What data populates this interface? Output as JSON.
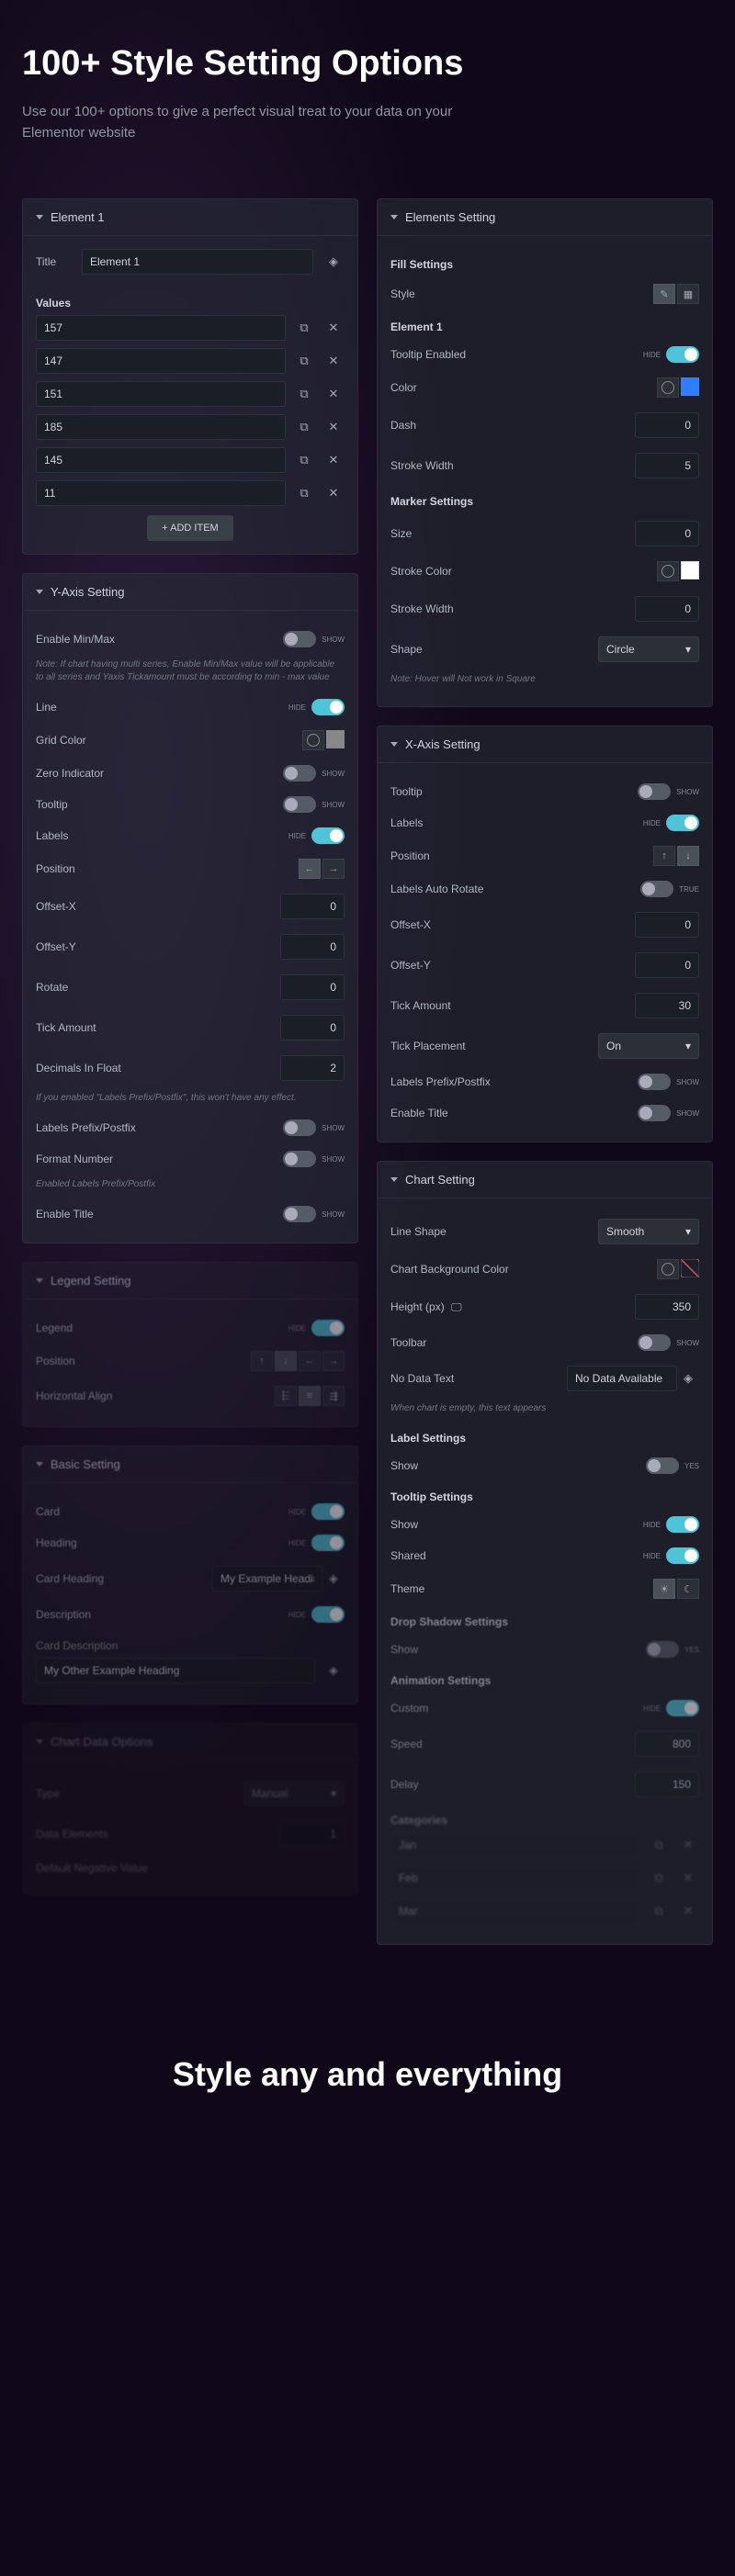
{
  "hero": {
    "title": "100+ Style Setting Options",
    "subtitle": "Use our 100+ options to give a perfect visual treat to your data on your Elementor website"
  },
  "element1": {
    "header": "Element 1",
    "titleLabel": "Title",
    "titleValue": "Element 1",
    "valuesLabel": "Values",
    "values": [
      "157",
      "147",
      "151",
      "185",
      "145",
      "11"
    ],
    "addItem": "+  ADD ITEM"
  },
  "yaxis": {
    "header": "Y-Axis Setting",
    "enableMinMax": "Enable Min/Max",
    "note1": "Note: If chart having multi series, Enable Min/Max value will be applicable to all series and Yaxis Tickamount must be according to min - max value",
    "line": "Line",
    "gridColor": "Grid Color",
    "zeroIndicator": "Zero Indicator",
    "tooltip": "Tooltip",
    "labels": "Labels",
    "position": "Position",
    "offsetX": "Offset-X",
    "offsetXVal": "0",
    "offsetY": "Offset-Y",
    "offsetYVal": "0",
    "rotate": "Rotate",
    "rotateVal": "0",
    "tickAmount": "Tick Amount",
    "tickAmountVal": "0",
    "decimals": "Decimals In Float",
    "decimalsVal": "2",
    "note2": "If you enabled \"Labels Prefix/Postfix\", this won't have any effect.",
    "labelsPrefix": "Labels Prefix/Postfix",
    "formatNumber": "Format Number",
    "note3": "Enabled Labels Prefix/Postfix",
    "enableTitle": "Enable Title"
  },
  "legend": {
    "header": "Legend Setting",
    "legend": "Legend",
    "position": "Position",
    "hAlign": "Horizontal Align"
  },
  "basic": {
    "header": "Basic Setting",
    "card": "Card",
    "heading": "Heading",
    "cardHeading": "Card Heading",
    "cardHeadingVal": "My Example Headin",
    "description": "Description",
    "cardDescription": "Card Description",
    "cardDescriptionVal": "My Other Example Heading"
  },
  "chartDataOpt": {
    "header": "Chart Data Options",
    "type": "Type",
    "typeVal": "Manual",
    "dataElements": "Data Elements",
    "dataElementsVal": "1",
    "defaultNeg": "Default Negative Value"
  },
  "elementsSetting": {
    "header": "Elements Setting",
    "fillSettings": "Fill Settings",
    "style": "Style",
    "element1": "Element 1",
    "tooltipEnabled": "Tooltip Enabled",
    "color": "Color",
    "dash": "Dash",
    "dashVal": "0",
    "strokeWidth": "Stroke Width",
    "strokeWidthVal": "5",
    "markerSettings": "Marker Settings",
    "size": "Size",
    "sizeVal": "0",
    "strokeColor": "Stroke Color",
    "strokeWidth2": "Stroke Width",
    "strokeWidth2Val": "0",
    "shape": "Shape",
    "shapeVal": "Circle",
    "note": "Note: Hover will Not work in Square"
  },
  "xaxis": {
    "header": "X-Axis Setting",
    "tooltip": "Tooltip",
    "labels": "Labels",
    "position": "Position",
    "labelsAutoRotate": "Labels Auto Rotate",
    "offsetX": "Offset-X",
    "offsetXVal": "0",
    "offsetY": "Offset-Y",
    "offsetYVal": "0",
    "tickAmount": "Tick Amount",
    "tickAmountVal": "30",
    "tickPlacement": "Tick Placement",
    "tickPlacementVal": "On",
    "labelsPrefix": "Labels Prefix/Postfix",
    "enableTitle": "Enable Title"
  },
  "chartSetting": {
    "header": "Chart Setting",
    "lineShape": "Line Shape",
    "lineShapeVal": "Smooth",
    "chartBg": "Chart Background Color",
    "height": "Height (px)",
    "heightVal": "350",
    "toolbar": "Toolbar",
    "noDataText": "No Data Text",
    "noDataTextVal": "No Data Available",
    "note1": "When chart is empty, this text appears",
    "labelSettings": "Label Settings",
    "show": "Show",
    "tooltipSettings": "Tooltip Settings",
    "shared": "Shared",
    "theme": "Theme",
    "dropShadow": "Drop Shadow Settings",
    "animation": "Animation Settings",
    "custom": "Custom",
    "speed": "Speed",
    "speedVal": "800",
    "delay": "Delay",
    "delayVal": "150",
    "categories": "Categories",
    "months": [
      "Jan",
      "Feb",
      "Mar"
    ]
  },
  "labels": {
    "show": "SHOW",
    "hide": "HIDE",
    "yes": "YES",
    "true": "TRUE"
  },
  "footer": "Style any and everything"
}
